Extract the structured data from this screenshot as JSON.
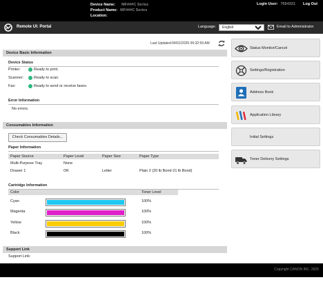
{
  "header": {
    "device_name_label": "Device Name:",
    "device_name_value": "MF###C Series",
    "product_name_label": "Product Name:",
    "product_name_value": "MF###C Series",
    "location_label": "Location:",
    "login_user_label": "Login User:",
    "login_user_value": "7654321",
    "logout_label": "Log Out"
  },
  "nav": {
    "title": "Remote UI: Portal",
    "language_label": "Language:",
    "language_value": "English",
    "email_label": "Email to Administrator"
  },
  "last_updated": "Last Updated:04/01/2025 06:32:59 AM",
  "device_basic": {
    "title": "Device Basic Information",
    "status_title": "Device Status",
    "rows": [
      {
        "label": "Printer:",
        "status": "Ready to print."
      },
      {
        "label": "Scanner:",
        "status": "Ready to scan."
      },
      {
        "label": "Fax:",
        "status": "Ready to send or receive faxes."
      }
    ],
    "error_title": "Error Information",
    "error_text": "No errors."
  },
  "consumables": {
    "title": "Consumables Information",
    "check_button": "Check Consumables Details...",
    "paper_title": "Paper Information",
    "paper_headers": [
      "Paper Source",
      "Paper Level",
      "Paper Size",
      "Paper Type"
    ],
    "paper_rows": [
      [
        "Multi-Purpose Tray",
        "None",
        "",
        ""
      ],
      [
        "Drawer 1",
        "OK",
        "Letter",
        "Plain 2 (20 lb Bond-21 lb Bond)"
      ]
    ],
    "cartridge_title": "Cartridge Information",
    "cartridge_headers": [
      "Color",
      "Toner Level"
    ],
    "cartridges": [
      {
        "name": "Cyan",
        "level": "100%",
        "fraction": 1.0,
        "color": "#1ec8f0"
      },
      {
        "name": "Magenta",
        "level": "100%",
        "fraction": 1.0,
        "color": "#e020c8"
      },
      {
        "name": "Yellow",
        "level": "100%",
        "fraction": 1.0,
        "color": "#f8cc00"
      },
      {
        "name": "Black",
        "level": "100%",
        "fraction": 1.0,
        "color": "#000000"
      }
    ]
  },
  "support": {
    "title": "Support Link",
    "link_label": "Support Link:"
  },
  "sidebar": {
    "items": [
      {
        "label": "Status Monitor/Cancel",
        "icon": "eye-icon"
      },
      {
        "label": "Settings/Registration",
        "icon": "settings-icon"
      },
      {
        "label": "Address Book",
        "icon": "address-book-icon"
      },
      {
        "label": "Application Library",
        "icon": "application-library-icon"
      },
      {
        "label": "Initial Settings",
        "icon": ""
      },
      {
        "label": "Toner Delivery Settings",
        "icon": "truck-icon"
      }
    ]
  },
  "footer": {
    "copyright": "Copyright CANON INC. 2025"
  },
  "colors": {
    "status_ready": "#2db87e",
    "address_book": "#1e6fb8"
  }
}
